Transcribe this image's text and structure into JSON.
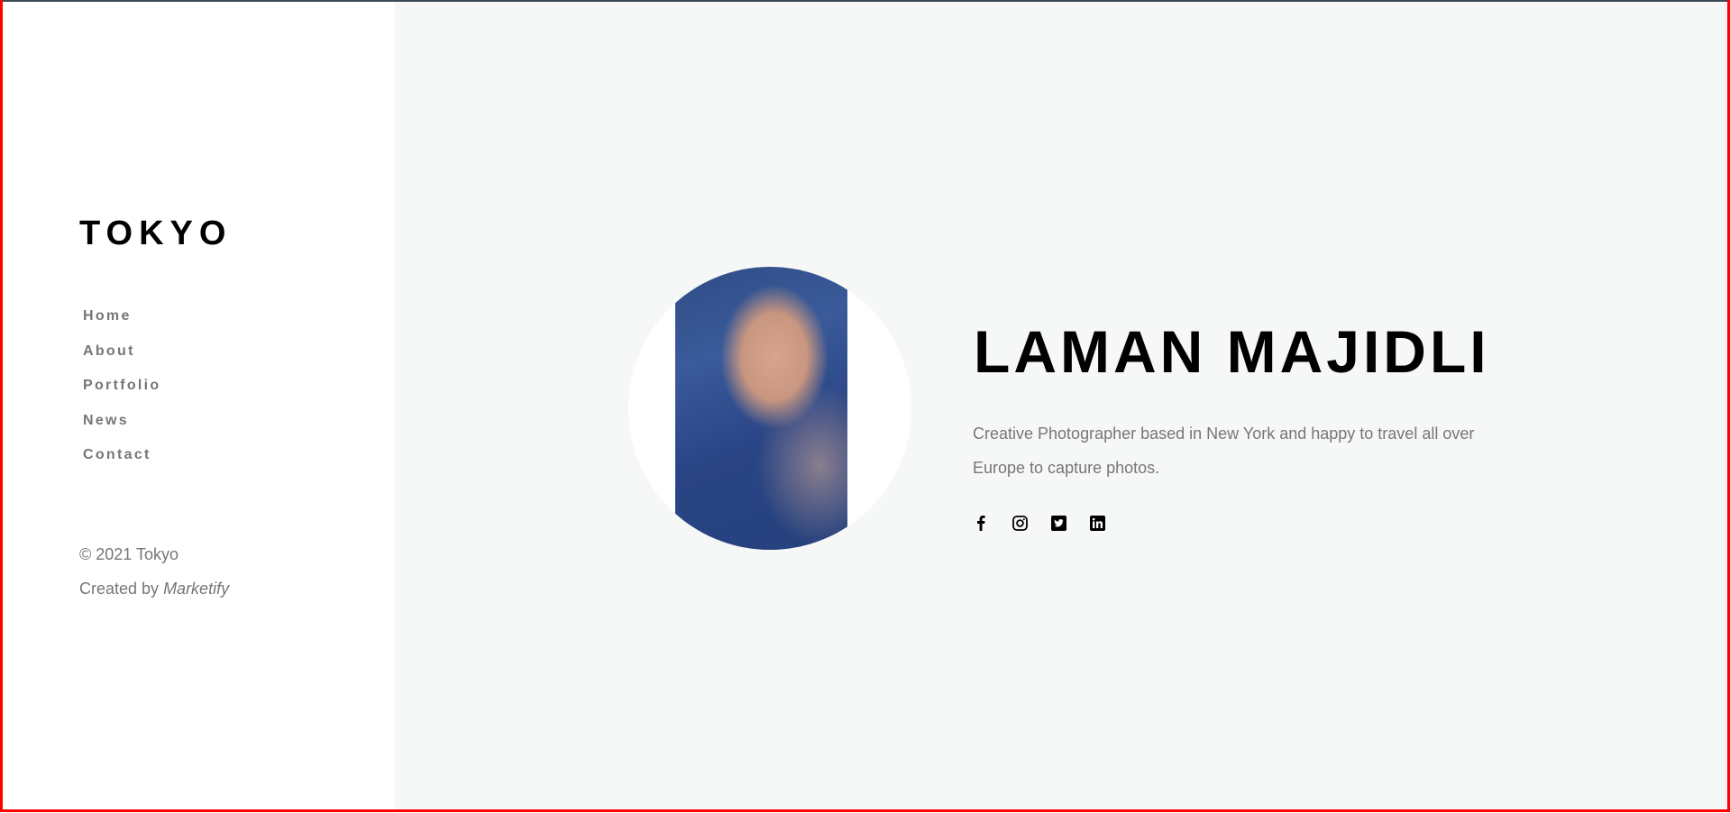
{
  "sidebar": {
    "logo": "TOKYO",
    "nav": [
      {
        "label": "Home"
      },
      {
        "label": "About"
      },
      {
        "label": "Portfolio"
      },
      {
        "label": "News"
      },
      {
        "label": "Contact"
      }
    ],
    "copyright": "© 2021 Tokyo",
    "created_by_prefix": "Created by ",
    "created_by_name": "Marketify"
  },
  "hero": {
    "name": "LAMAN MAJIDLI",
    "description": "Creative Photographer based in New York and happy to travel all over Europe to capture photos.",
    "social": [
      {
        "icon": "facebook-icon"
      },
      {
        "icon": "instagram-icon"
      },
      {
        "icon": "twitter-icon"
      },
      {
        "icon": "linkedin-icon"
      }
    ]
  },
  "colors": {
    "text_muted": "#767676",
    "main_bg": "#f6f8f7",
    "frame": "#ff0000"
  }
}
